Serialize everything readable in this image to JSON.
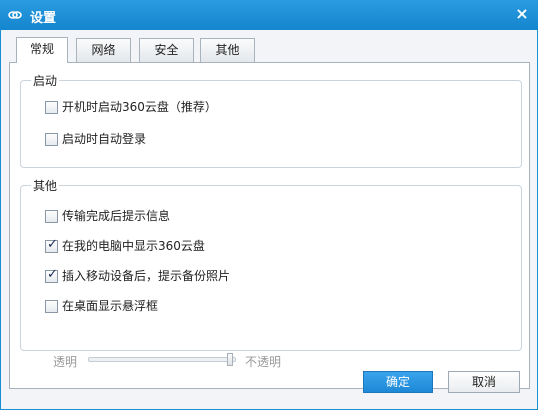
{
  "window": {
    "title": "设置",
    "close_symbol": "×",
    "logo_icon": "360-cloud-logo-icon",
    "title_bar_color": "#1a8fd1"
  },
  "tabs": [
    {
      "label": "常规",
      "active": true
    },
    {
      "label": "网络",
      "active": false
    },
    {
      "label": "安全",
      "active": false
    },
    {
      "label": "其他",
      "active": false
    }
  ],
  "startup_group": {
    "title": "启动",
    "options": [
      {
        "label": "开机时启动360云盘（推荐）",
        "checked": false
      },
      {
        "label": "启动时自动登录",
        "checked": false
      }
    ]
  },
  "other_group": {
    "title": "其他",
    "options": [
      {
        "label": "传输完成后提示信息",
        "checked": false
      },
      {
        "label": "在我的电脑中显示360云盘",
        "checked": true
      },
      {
        "label": "插入移动设备后，提示备份照片",
        "checked": true
      },
      {
        "label": "在桌面显示悬浮框",
        "checked": false
      }
    ],
    "opacity_slider": {
      "min_label": "透明",
      "max_label": "不透明",
      "value_fraction": 1.0,
      "enabled": false
    }
  },
  "buttons": {
    "ok": "确定",
    "cancel": "取消"
  },
  "check_symbol": "✓"
}
